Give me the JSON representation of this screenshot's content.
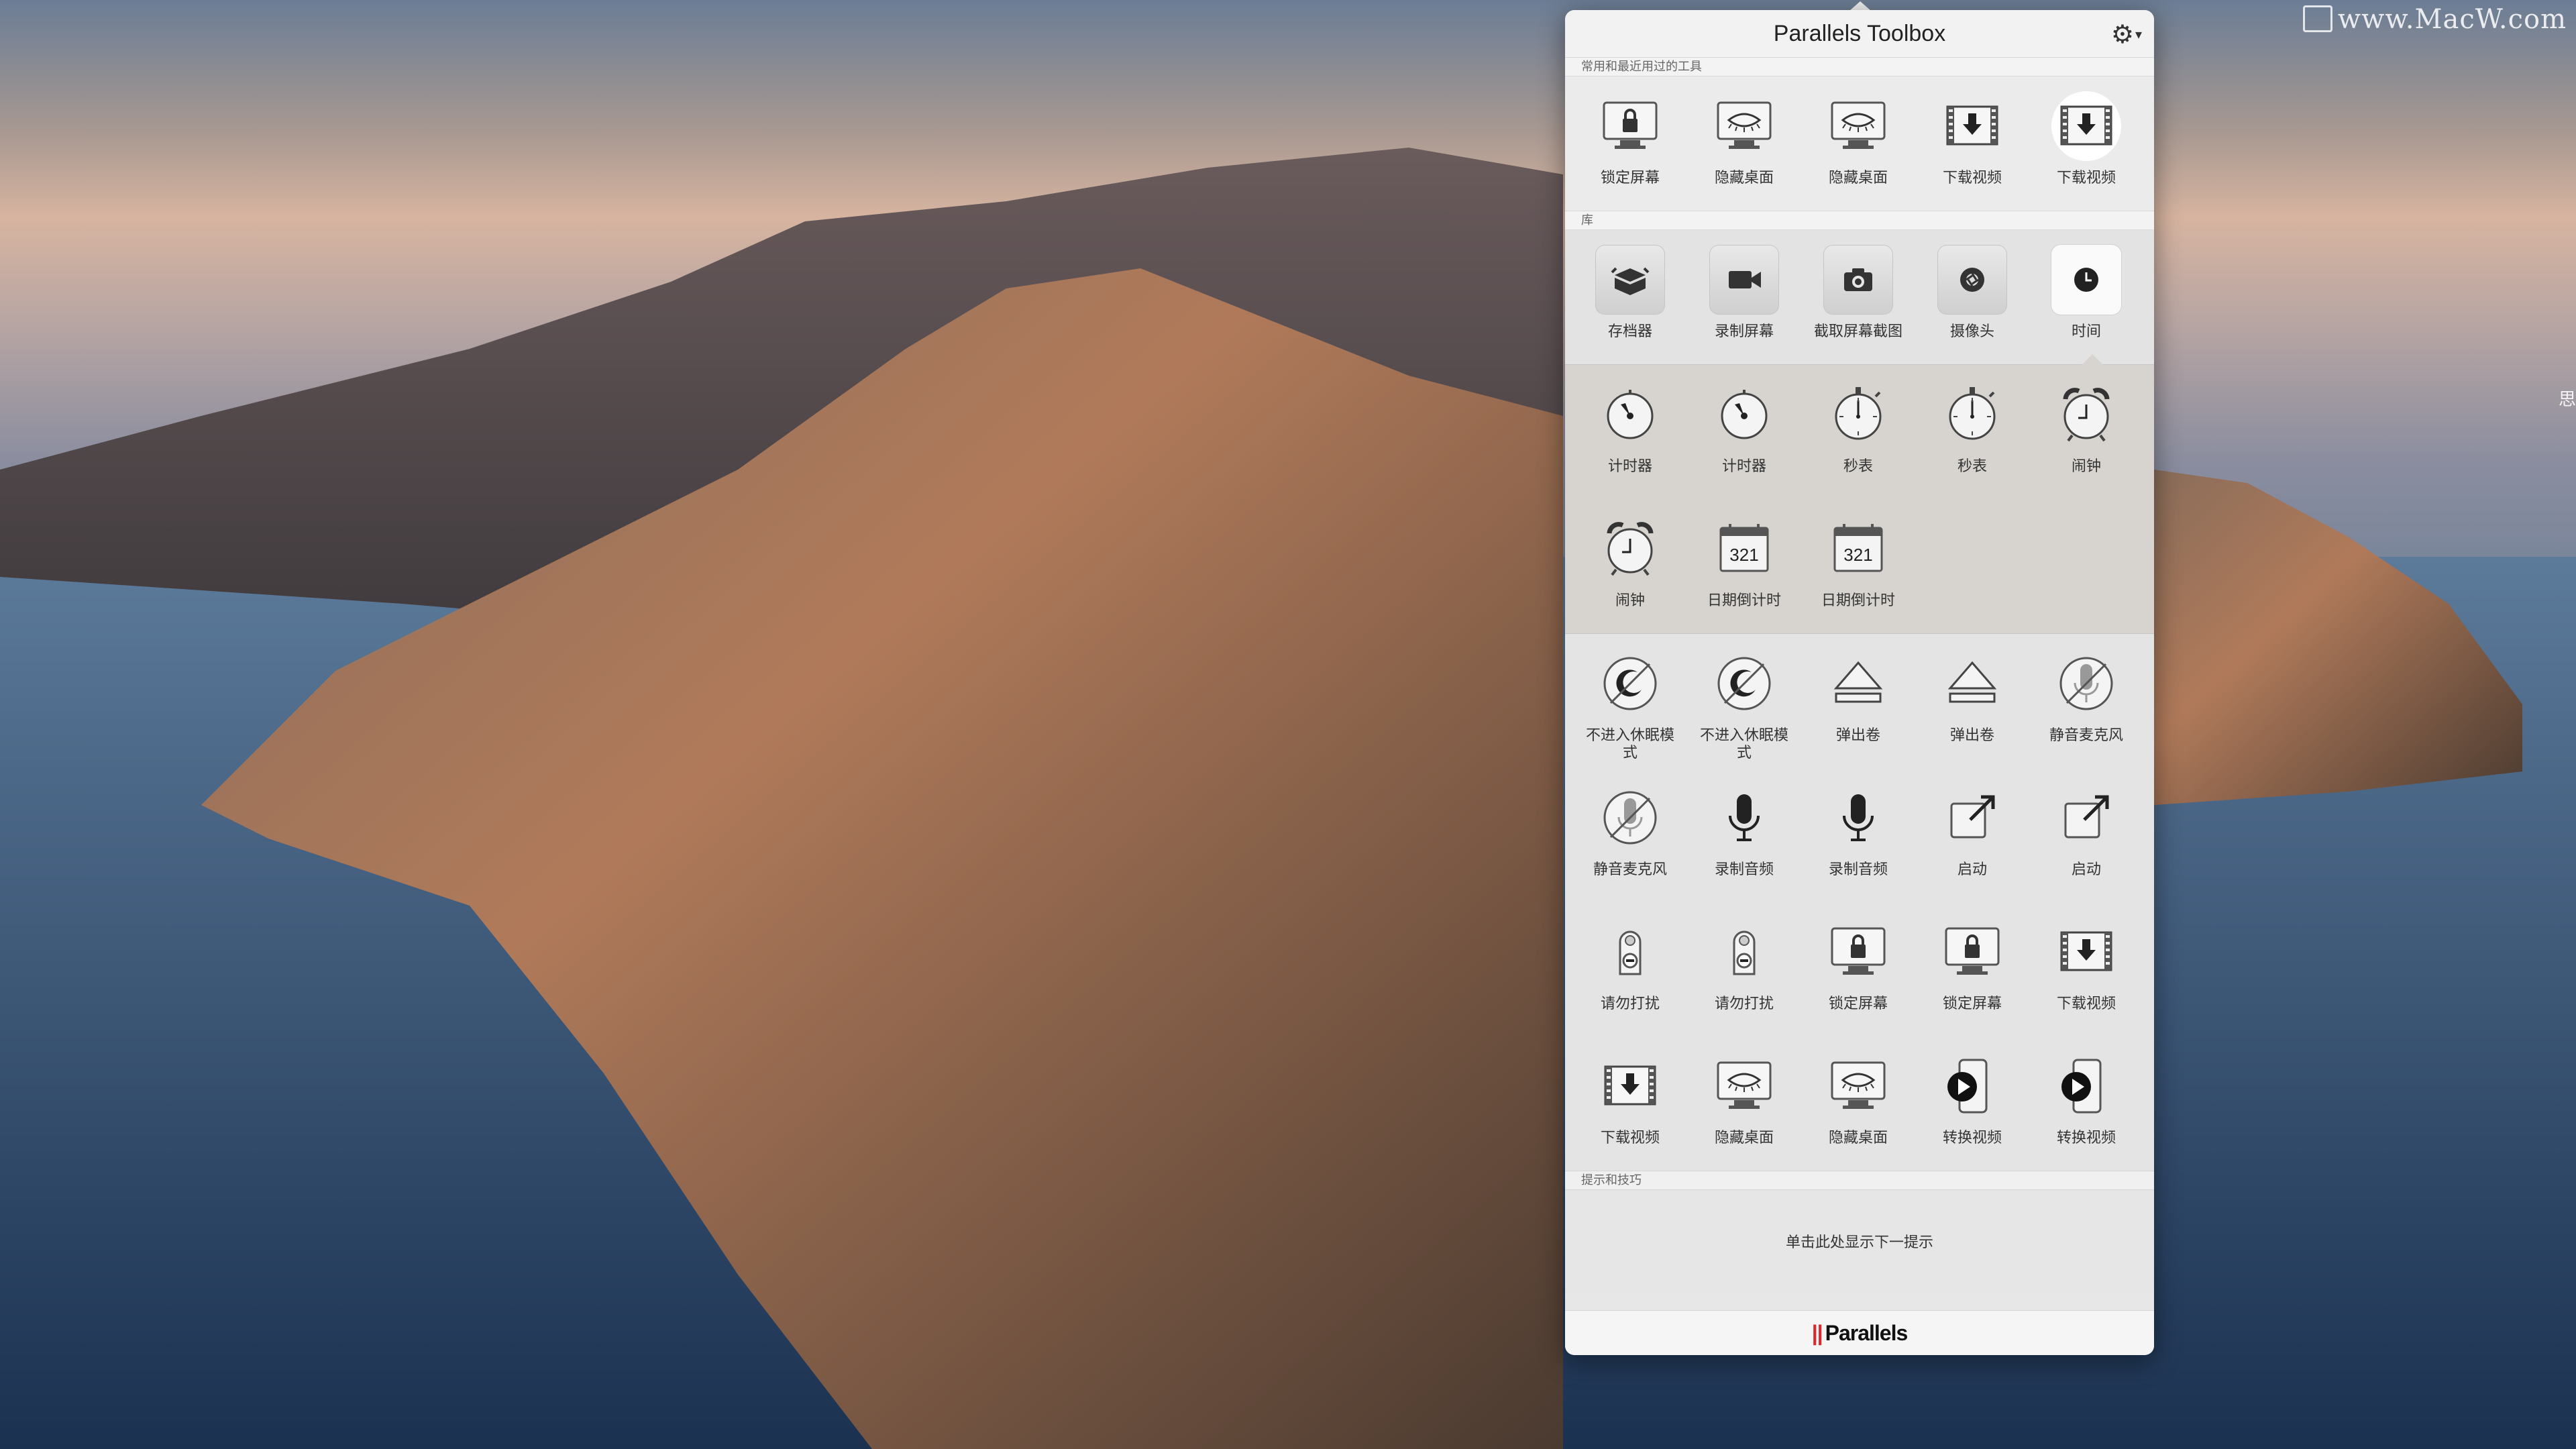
{
  "watermark": "www.MacW.com",
  "edge_text": "思",
  "panel": {
    "title": "Parallels Toolbox",
    "recent_label": "常用和最近用过的工具",
    "library_label": "库",
    "tips_label": "提示和技巧",
    "tips_text": "单击此处显示下一提示",
    "brand": "Parallels"
  },
  "recent": [
    {
      "label": "锁定屏幕",
      "icon": "lock-screen-icon"
    },
    {
      "label": "隐藏桌面",
      "icon": "hide-desktop-icon"
    },
    {
      "label": "隐藏桌面",
      "icon": "hide-desktop-icon"
    },
    {
      "label": "下载视频",
      "icon": "download-video-icon"
    },
    {
      "label": "下载视频",
      "icon": "download-video-icon",
      "active": true
    }
  ],
  "library": [
    {
      "label": "存档器",
      "icon": "archiver-icon"
    },
    {
      "label": "录制屏幕",
      "icon": "record-screen-icon"
    },
    {
      "label": "截取屏幕截图",
      "icon": "screenshot-icon"
    },
    {
      "label": "摄像头",
      "icon": "camera-icon"
    },
    {
      "label": "时间",
      "icon": "clock-icon",
      "active": true
    }
  ],
  "time_tools": [
    {
      "label": "计时器",
      "icon": "timer-icon"
    },
    {
      "label": "计时器",
      "icon": "timer-icon"
    },
    {
      "label": "秒表",
      "icon": "stopwatch-icon"
    },
    {
      "label": "秒表",
      "icon": "stopwatch-icon"
    },
    {
      "label": "闹钟",
      "icon": "alarm-icon"
    },
    {
      "label": "闹钟",
      "icon": "alarm-icon"
    },
    {
      "label": "日期倒计时",
      "icon": "date-countdown-icon",
      "number": "321"
    },
    {
      "label": "日期倒计时",
      "icon": "date-countdown-icon",
      "number": "321"
    }
  ],
  "more_tools": [
    {
      "label": "不进入休眠模式",
      "icon": "no-sleep-icon"
    },
    {
      "label": "不进入休眠模式",
      "icon": "no-sleep-icon"
    },
    {
      "label": "弹出卷",
      "icon": "eject-icon"
    },
    {
      "label": "弹出卷",
      "icon": "eject-icon"
    },
    {
      "label": "静音麦克风",
      "icon": "mute-mic-icon"
    },
    {
      "label": "静音麦克风",
      "icon": "mute-mic-icon"
    },
    {
      "label": "录制音频",
      "icon": "mic-icon"
    },
    {
      "label": "录制音频",
      "icon": "mic-icon"
    },
    {
      "label": "启动",
      "icon": "launch-icon"
    },
    {
      "label": "启动",
      "icon": "launch-icon"
    },
    {
      "label": "请勿打扰",
      "icon": "do-not-disturb-icon"
    },
    {
      "label": "请勿打扰",
      "icon": "do-not-disturb-icon"
    },
    {
      "label": "锁定屏幕",
      "icon": "lock-screen-icon"
    },
    {
      "label": "锁定屏幕",
      "icon": "lock-screen-icon"
    },
    {
      "label": "下载视频",
      "icon": "download-video-icon"
    },
    {
      "label": "下载视频",
      "icon": "download-video-icon"
    },
    {
      "label": "隐藏桌面",
      "icon": "hide-desktop-icon"
    },
    {
      "label": "隐藏桌面",
      "icon": "hide-desktop-icon"
    },
    {
      "label": "转换视频",
      "icon": "convert-video-icon"
    },
    {
      "label": "转换视频",
      "icon": "convert-video-icon"
    }
  ],
  "colors": {
    "accent": "#e0262b",
    "panel_bg": "#e7e7e7"
  }
}
